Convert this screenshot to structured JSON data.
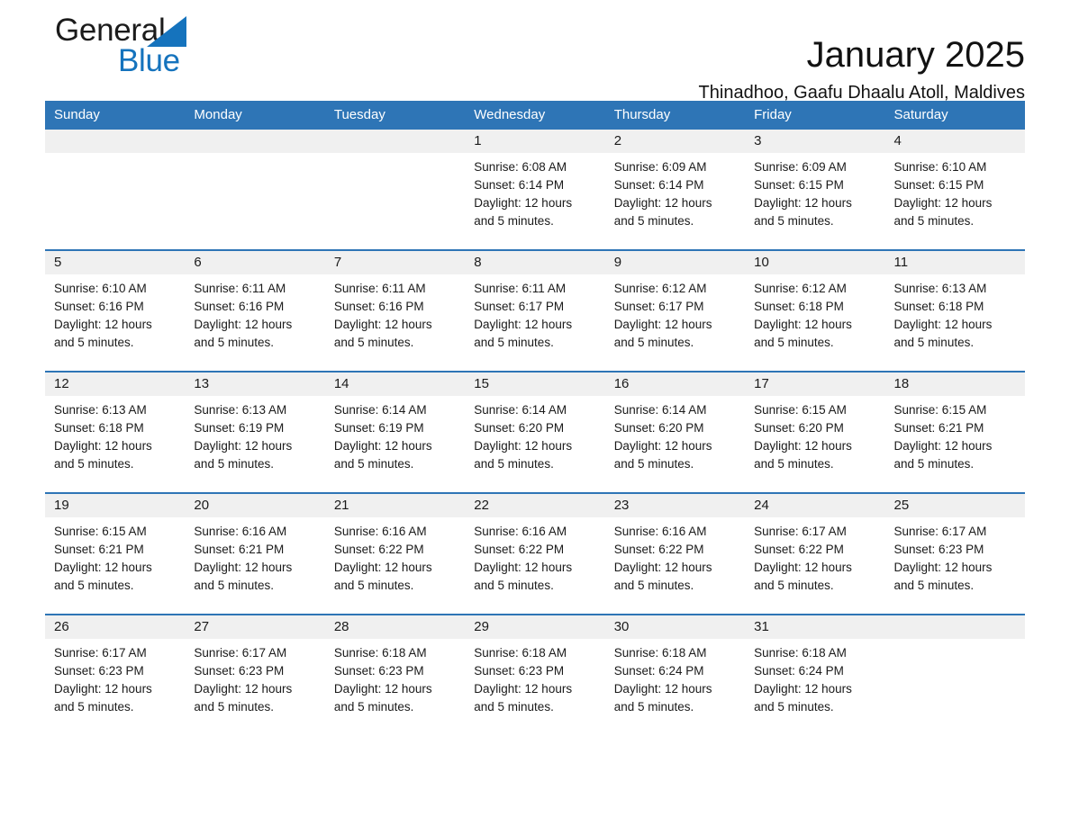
{
  "brand": {
    "name_part1": "General",
    "name_part2": "Blue",
    "triangle_color": "#1573bd",
    "logo_icon": "triangle-logo-icon"
  },
  "header": {
    "title": "January 2025",
    "subtitle": "Thinadhoo, Gaafu Dhaalu Atoll, Maldives"
  },
  "colors": {
    "header_blue": "#2e75b6",
    "brand_blue": "#1573bd",
    "daynum_band": "#f0f0f0",
    "text": "#1a1a1a"
  },
  "weekdays": [
    "Sunday",
    "Monday",
    "Tuesday",
    "Wednesday",
    "Thursday",
    "Friday",
    "Saturday"
  ],
  "weeks": [
    [
      {
        "day": "",
        "sunrise": "",
        "sunset": "",
        "daylight": "",
        "daylight2": "",
        "empty": true
      },
      {
        "day": "",
        "sunrise": "",
        "sunset": "",
        "daylight": "",
        "daylight2": "",
        "empty": true
      },
      {
        "day": "",
        "sunrise": "",
        "sunset": "",
        "daylight": "",
        "daylight2": "",
        "empty": true
      },
      {
        "day": "1",
        "sunrise": "Sunrise: 6:08 AM",
        "sunset": "Sunset: 6:14 PM",
        "daylight": "Daylight: 12 hours",
        "daylight2": "and 5 minutes."
      },
      {
        "day": "2",
        "sunrise": "Sunrise: 6:09 AM",
        "sunset": "Sunset: 6:14 PM",
        "daylight": "Daylight: 12 hours",
        "daylight2": "and 5 minutes."
      },
      {
        "day": "3",
        "sunrise": "Sunrise: 6:09 AM",
        "sunset": "Sunset: 6:15 PM",
        "daylight": "Daylight: 12 hours",
        "daylight2": "and 5 minutes."
      },
      {
        "day": "4",
        "sunrise": "Sunrise: 6:10 AM",
        "sunset": "Sunset: 6:15 PM",
        "daylight": "Daylight: 12 hours",
        "daylight2": "and 5 minutes."
      }
    ],
    [
      {
        "day": "5",
        "sunrise": "Sunrise: 6:10 AM",
        "sunset": "Sunset: 6:16 PM",
        "daylight": "Daylight: 12 hours",
        "daylight2": "and 5 minutes."
      },
      {
        "day": "6",
        "sunrise": "Sunrise: 6:11 AM",
        "sunset": "Sunset: 6:16 PM",
        "daylight": "Daylight: 12 hours",
        "daylight2": "and 5 minutes."
      },
      {
        "day": "7",
        "sunrise": "Sunrise: 6:11 AM",
        "sunset": "Sunset: 6:16 PM",
        "daylight": "Daylight: 12 hours",
        "daylight2": "and 5 minutes."
      },
      {
        "day": "8",
        "sunrise": "Sunrise: 6:11 AM",
        "sunset": "Sunset: 6:17 PM",
        "daylight": "Daylight: 12 hours",
        "daylight2": "and 5 minutes."
      },
      {
        "day": "9",
        "sunrise": "Sunrise: 6:12 AM",
        "sunset": "Sunset: 6:17 PM",
        "daylight": "Daylight: 12 hours",
        "daylight2": "and 5 minutes."
      },
      {
        "day": "10",
        "sunrise": "Sunrise: 6:12 AM",
        "sunset": "Sunset: 6:18 PM",
        "daylight": "Daylight: 12 hours",
        "daylight2": "and 5 minutes."
      },
      {
        "day": "11",
        "sunrise": "Sunrise: 6:13 AM",
        "sunset": "Sunset: 6:18 PM",
        "daylight": "Daylight: 12 hours",
        "daylight2": "and 5 minutes."
      }
    ],
    [
      {
        "day": "12",
        "sunrise": "Sunrise: 6:13 AM",
        "sunset": "Sunset: 6:18 PM",
        "daylight": "Daylight: 12 hours",
        "daylight2": "and 5 minutes."
      },
      {
        "day": "13",
        "sunrise": "Sunrise: 6:13 AM",
        "sunset": "Sunset: 6:19 PM",
        "daylight": "Daylight: 12 hours",
        "daylight2": "and 5 minutes."
      },
      {
        "day": "14",
        "sunrise": "Sunrise: 6:14 AM",
        "sunset": "Sunset: 6:19 PM",
        "daylight": "Daylight: 12 hours",
        "daylight2": "and 5 minutes."
      },
      {
        "day": "15",
        "sunrise": "Sunrise: 6:14 AM",
        "sunset": "Sunset: 6:20 PM",
        "daylight": "Daylight: 12 hours",
        "daylight2": "and 5 minutes."
      },
      {
        "day": "16",
        "sunrise": "Sunrise: 6:14 AM",
        "sunset": "Sunset: 6:20 PM",
        "daylight": "Daylight: 12 hours",
        "daylight2": "and 5 minutes."
      },
      {
        "day": "17",
        "sunrise": "Sunrise: 6:15 AM",
        "sunset": "Sunset: 6:20 PM",
        "daylight": "Daylight: 12 hours",
        "daylight2": "and 5 minutes."
      },
      {
        "day": "18",
        "sunrise": "Sunrise: 6:15 AM",
        "sunset": "Sunset: 6:21 PM",
        "daylight": "Daylight: 12 hours",
        "daylight2": "and 5 minutes."
      }
    ],
    [
      {
        "day": "19",
        "sunrise": "Sunrise: 6:15 AM",
        "sunset": "Sunset: 6:21 PM",
        "daylight": "Daylight: 12 hours",
        "daylight2": "and 5 minutes."
      },
      {
        "day": "20",
        "sunrise": "Sunrise: 6:16 AM",
        "sunset": "Sunset: 6:21 PM",
        "daylight": "Daylight: 12 hours",
        "daylight2": "and 5 minutes."
      },
      {
        "day": "21",
        "sunrise": "Sunrise: 6:16 AM",
        "sunset": "Sunset: 6:22 PM",
        "daylight": "Daylight: 12 hours",
        "daylight2": "and 5 minutes."
      },
      {
        "day": "22",
        "sunrise": "Sunrise: 6:16 AM",
        "sunset": "Sunset: 6:22 PM",
        "daylight": "Daylight: 12 hours",
        "daylight2": "and 5 minutes."
      },
      {
        "day": "23",
        "sunrise": "Sunrise: 6:16 AM",
        "sunset": "Sunset: 6:22 PM",
        "daylight": "Daylight: 12 hours",
        "daylight2": "and 5 minutes."
      },
      {
        "day": "24",
        "sunrise": "Sunrise: 6:17 AM",
        "sunset": "Sunset: 6:22 PM",
        "daylight": "Daylight: 12 hours",
        "daylight2": "and 5 minutes."
      },
      {
        "day": "25",
        "sunrise": "Sunrise: 6:17 AM",
        "sunset": "Sunset: 6:23 PM",
        "daylight": "Daylight: 12 hours",
        "daylight2": "and 5 minutes."
      }
    ],
    [
      {
        "day": "26",
        "sunrise": "Sunrise: 6:17 AM",
        "sunset": "Sunset: 6:23 PM",
        "daylight": "Daylight: 12 hours",
        "daylight2": "and 5 minutes."
      },
      {
        "day": "27",
        "sunrise": "Sunrise: 6:17 AM",
        "sunset": "Sunset: 6:23 PM",
        "daylight": "Daylight: 12 hours",
        "daylight2": "and 5 minutes."
      },
      {
        "day": "28",
        "sunrise": "Sunrise: 6:18 AM",
        "sunset": "Sunset: 6:23 PM",
        "daylight": "Daylight: 12 hours",
        "daylight2": "and 5 minutes."
      },
      {
        "day": "29",
        "sunrise": "Sunrise: 6:18 AM",
        "sunset": "Sunset: 6:23 PM",
        "daylight": "Daylight: 12 hours",
        "daylight2": "and 5 minutes."
      },
      {
        "day": "30",
        "sunrise": "Sunrise: 6:18 AM",
        "sunset": "Sunset: 6:24 PM",
        "daylight": "Daylight: 12 hours",
        "daylight2": "and 5 minutes."
      },
      {
        "day": "31",
        "sunrise": "Sunrise: 6:18 AM",
        "sunset": "Sunset: 6:24 PM",
        "daylight": "Daylight: 12 hours",
        "daylight2": "and 5 minutes."
      },
      {
        "day": "",
        "sunrise": "",
        "sunset": "",
        "daylight": "",
        "daylight2": "",
        "empty": true
      }
    ]
  ]
}
